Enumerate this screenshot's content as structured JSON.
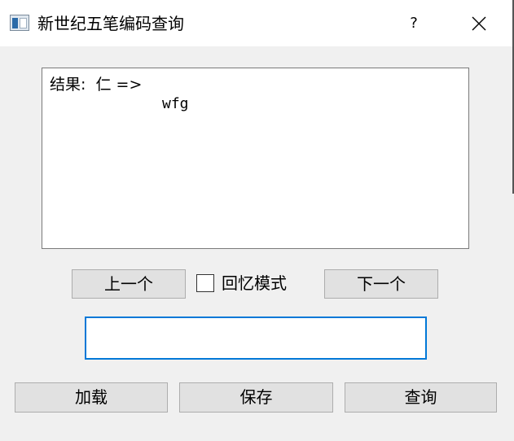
{
  "window": {
    "title": "新世纪五笔编码查询",
    "help_label": "?",
    "icon": "app-window-icon"
  },
  "result": {
    "line1": "结果:  仁 =>",
    "line2": "wfg"
  },
  "nav": {
    "prev_label": "上一个",
    "next_label": "下一个",
    "memory_mode_label": "回忆模式",
    "memory_mode_checked": false
  },
  "search": {
    "value": "",
    "placeholder": ""
  },
  "actions": {
    "load_label": "加载",
    "save_label": "保存",
    "query_label": "查询"
  },
  "colors": {
    "input_focus_border": "#0078d7",
    "button_bg": "#e1e1e1",
    "window_bg": "#f0f0f0"
  }
}
